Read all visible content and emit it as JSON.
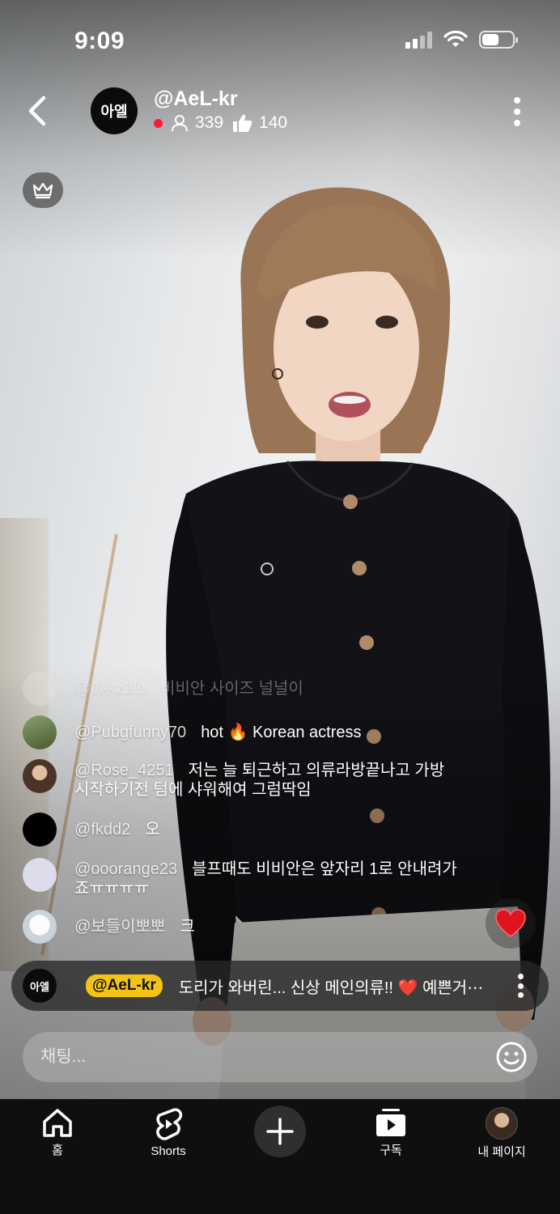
{
  "status_bar": {
    "time": "9:09"
  },
  "header": {
    "channel_avatar_text": "아엘",
    "channel_name": "@AeL-kr",
    "viewers": "339",
    "likes": "140"
  },
  "chat": [
    {
      "user": "@Ji-kz2lb",
      "message": "비비안 사이즈 널널이",
      "faded": true,
      "avatar_color": "#e8e6e3"
    },
    {
      "user": "@Pubgfunny70",
      "message": "hot 🔥 Korean actress",
      "faded": false,
      "avatar_color": "#5b6b3c"
    },
    {
      "user": "@Rose_4251",
      "message": "저는 늘 퇴근하고 의류라방끝나고 가방 시작하기전 텀에 샤워해여 그럼딱임",
      "faded": false,
      "avatar_color": "#6a5040"
    },
    {
      "user": "@fkdd2",
      "message": "오",
      "faded": false,
      "avatar_color": "#000000"
    },
    {
      "user": "@ooorange23",
      "message": "블프때도 비비안은 앞자리 1로 안내려가죠ㅠㅠㅠㅠ",
      "faded": false,
      "avatar_color": "#dcdcea"
    },
    {
      "user": "@보들이뽀뽀",
      "message": "크",
      "faded": false,
      "avatar_color": "#e9eef1"
    }
  ],
  "pinned": {
    "avatar_text": "아엘",
    "tag": "@AeL-kr",
    "message": "도리가 와버린... 신상 메인의류!! ❤️ 예쁜거⋯"
  },
  "chat_input": {
    "placeholder": "채팅..."
  },
  "bottom_nav": {
    "home": "홈",
    "shorts": "Shorts",
    "subscriptions": "구독",
    "my_page": "내 페이지"
  },
  "colors": {
    "live": "#ff1a3a",
    "pinned_tag": "#f3c315",
    "heart": "#e0141e"
  }
}
